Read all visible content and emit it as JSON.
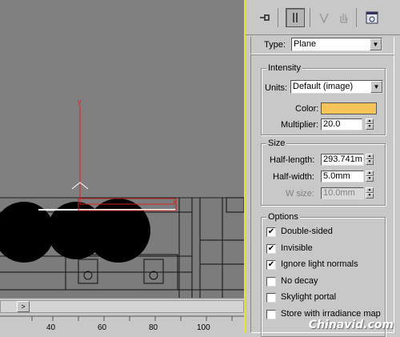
{
  "type_row": {
    "label": "Type:",
    "value": "Plane"
  },
  "intensity": {
    "title": "Intensity",
    "units_label": "Units:",
    "units_value": "Default (image)",
    "color_label": "Color:",
    "color_value": "#f7c45a",
    "multiplier_label": "Multiplier:",
    "multiplier_value": "20.0"
  },
  "size": {
    "title": "Size",
    "half_length_label": "Half-length:",
    "half_length_value": "293.741m",
    "half_width_label": "Half-width:",
    "half_width_value": "5.0mm",
    "w_size_label": "W size:",
    "w_size_value": "10.0mm"
  },
  "options": {
    "title": "Options",
    "items": [
      {
        "label": "Double-sided",
        "checked": true
      },
      {
        "label": "Invisible",
        "checked": true
      },
      {
        "label": "Ignore light normals",
        "checked": true
      },
      {
        "label": "No decay",
        "checked": false
      },
      {
        "label": "Skylight portal",
        "checked": false
      },
      {
        "label": "Store with irradiance map",
        "checked": false
      }
    ]
  },
  "viewport": {
    "axis_y": "y",
    "axis_x": "x"
  },
  "timeline": {
    "scroll_right": ">",
    "ticks": [
      "40",
      "60",
      "80",
      "100"
    ]
  },
  "watermark": "Chinavid.com",
  "icons": {
    "pin": "pin-icon",
    "modifier": "modifier-stack-icon",
    "funnel": "funnel-icon",
    "hand": "hand-icon",
    "configure": "configure-icon"
  }
}
